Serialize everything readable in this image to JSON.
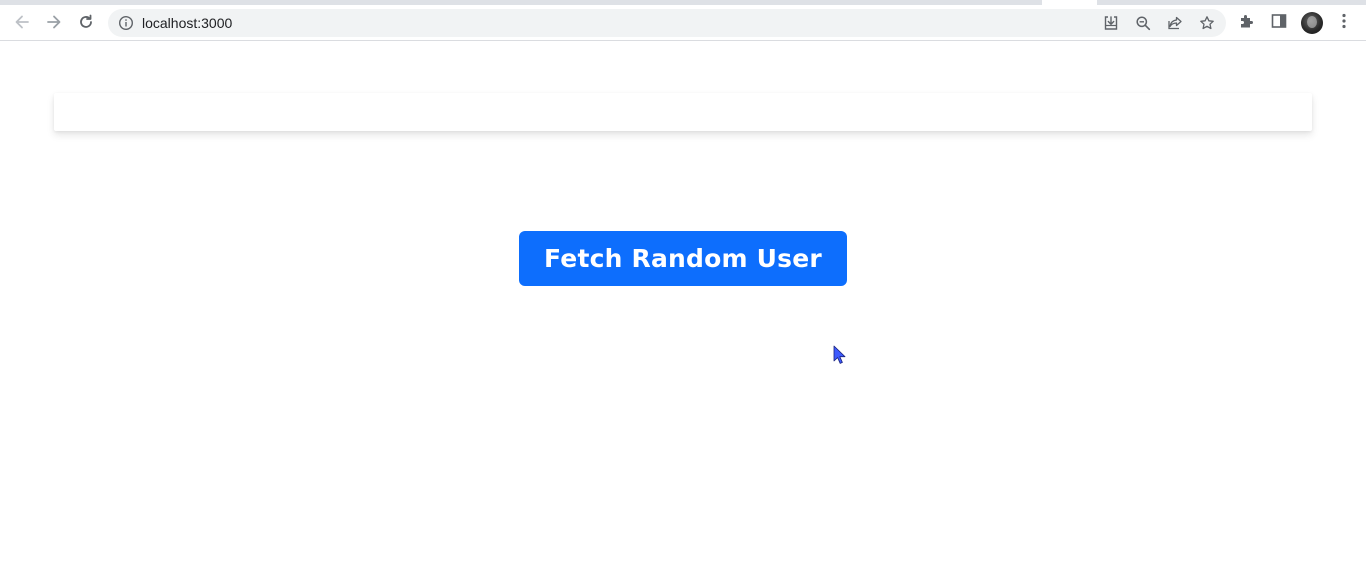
{
  "browser": {
    "url": "localhost:3000",
    "colors": {
      "icon": "#5f6368",
      "omnibox_bg": "#f1f3f4"
    }
  },
  "page": {
    "button_label": "Fetch Random User",
    "colors": {
      "button_bg": "#0d6efd",
      "button_text": "#ffffff",
      "cursor": "#3d5afe"
    }
  },
  "icons": {
    "back": "arrow-left-icon",
    "forward": "arrow-right-icon",
    "reload": "reload-icon",
    "site_info": "info-icon",
    "install": "install-icon",
    "zoom": "zoom-out-icon",
    "share": "share-icon",
    "bookmark": "star-icon",
    "extensions": "puzzle-icon",
    "side_panel": "side-panel-icon",
    "menu": "kebab-menu-icon"
  }
}
